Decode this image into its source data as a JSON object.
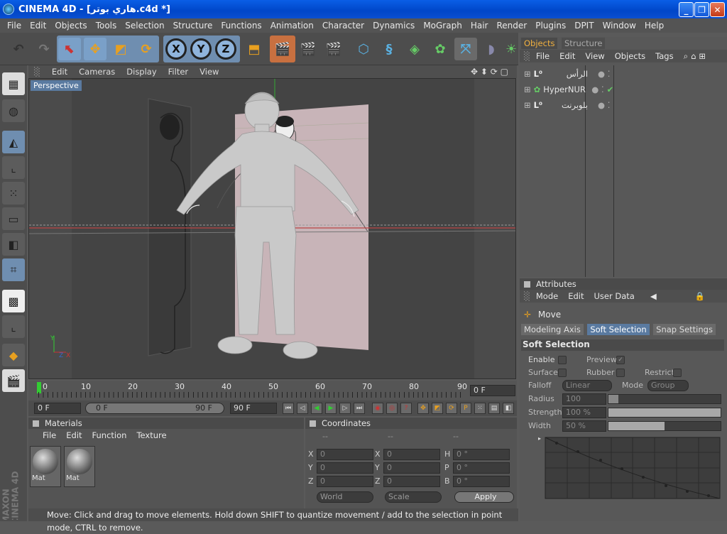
{
  "window": {
    "title": "CINEMA 4D - [هاري بوتر.c4d *]"
  },
  "menubar": [
    "File",
    "Edit",
    "Objects",
    "Tools",
    "Selection",
    "Structure",
    "Functions",
    "Animation",
    "Character",
    "Dynamics",
    "MoGraph",
    "Hair",
    "Render",
    "Plugins",
    "DPIT",
    "Window",
    "Help"
  ],
  "viewport": {
    "menu": [
      "Edit",
      "Cameras",
      "Display",
      "Filter",
      "View"
    ],
    "camera_label": "Perspective"
  },
  "timeline": {
    "ticks": [
      "0",
      "10",
      "20",
      "30",
      "40",
      "50",
      "60",
      "70",
      "80",
      "90"
    ],
    "frame_field": "0 F"
  },
  "timectl": {
    "start": "0 F",
    "range_start": "0 F",
    "range_end": "90 F",
    "end": "90 F"
  },
  "materials": {
    "title": "Materials",
    "menu": [
      "File",
      "Edit",
      "Function",
      "Texture"
    ],
    "items": [
      "Mat",
      "Mat"
    ]
  },
  "coordinates": {
    "title": "Coordinates",
    "col_headers": [
      "--",
      "--",
      "--"
    ],
    "rows": [
      [
        "X",
        "0",
        "X",
        "0",
        "H",
        "0 °"
      ],
      [
        "Y",
        "0",
        "Y",
        "0",
        "P",
        "0 °"
      ],
      [
        "Z",
        "0",
        "Z",
        "0",
        "B",
        "0 °"
      ]
    ],
    "world": "World",
    "scale": "Scale",
    "apply": "Apply"
  },
  "status": "Move: Click and drag to move elements. Hold down SHIFT to quantize movement / add to the selection in point mode, CTRL to remove.",
  "objects": {
    "tabs": [
      "Objects",
      "Structure"
    ],
    "menu": [
      "File",
      "Edit",
      "View",
      "Objects",
      "Tags"
    ],
    "items": [
      {
        "name": "الرأس"
      },
      {
        "name": "HyperNURBS"
      },
      {
        "name": "بلوبرنت"
      }
    ]
  },
  "attributes": {
    "title": "Attributes",
    "menu": [
      "Mode",
      "Edit",
      "User Data"
    ],
    "tool": "Move",
    "tabs": [
      "Modeling Axis",
      "Soft Selection",
      "Snap Settings"
    ],
    "section": "Soft Selection",
    "labels": {
      "enable": "Enable",
      "preview": "Preview",
      "surface": "Surface",
      "rubber": "Rubber",
      "restrict": "Restrict",
      "falloff": "Falloff",
      "falloff_val": "Linear",
      "mode": "Mode",
      "mode_val": "Group",
      "radius": "Radius",
      "radius_val": "100",
      "strength": "Strength",
      "strength_val": "100 %",
      "width": "Width",
      "width_val": "50 %"
    },
    "strength_fraction": 1.0,
    "width_fraction": 0.5
  },
  "brand": {
    "line1": "MAXON",
    "line2": "CINEMA 4D"
  }
}
